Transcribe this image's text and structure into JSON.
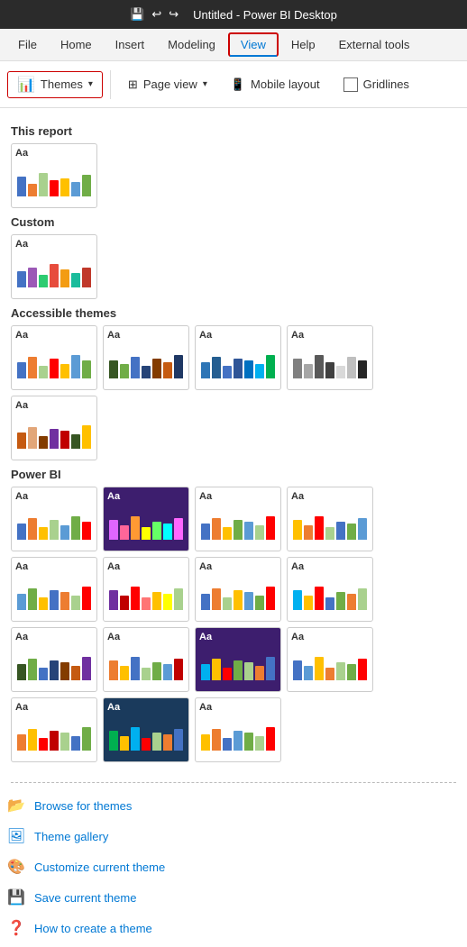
{
  "titleBar": {
    "title": "Untitled - Power BI Desktop",
    "saveIcon": "💾",
    "undoIcon": "↩",
    "redoIcon": "↪"
  },
  "menuBar": {
    "items": [
      {
        "label": "File",
        "active": false,
        "highlighted": false
      },
      {
        "label": "Home",
        "active": false,
        "highlighted": false
      },
      {
        "label": "Insert",
        "active": false,
        "highlighted": false
      },
      {
        "label": "Modeling",
        "active": false,
        "highlighted": false
      },
      {
        "label": "View",
        "active": true,
        "highlighted": true
      },
      {
        "label": "Help",
        "active": false,
        "highlighted": false
      },
      {
        "label": "External tools",
        "active": false,
        "highlighted": false
      }
    ]
  },
  "ribbon": {
    "themesLabel": "Themes",
    "pageViewLabel": "Page view",
    "mobileLayoutLabel": "Mobile layout",
    "gridlinesLabel": "Gridlines"
  },
  "dropdown": {
    "sections": [
      {
        "title": "This report",
        "themes": [
          {
            "id": "this-report-1",
            "aa": "Aa",
            "bg": "#fff",
            "bars": [
              {
                "color": "#4472c4",
                "h": 55
              },
              {
                "color": "#ed7d31",
                "h": 35
              },
              {
                "color": "#a9d18e",
                "h": 65
              },
              {
                "color": "#ff0000",
                "h": 45
              },
              {
                "color": "#ffc000",
                "h": 50
              },
              {
                "color": "#5b9bd5",
                "h": 40
              },
              {
                "color": "#70ad47",
                "h": 60
              }
            ]
          }
        ]
      },
      {
        "title": "Custom",
        "themes": [
          {
            "id": "custom-1",
            "aa": "Aa",
            "bg": "#fff",
            "bars": [
              {
                "color": "#4472c4",
                "h": 45
              },
              {
                "color": "#9b59b6",
                "h": 55
              },
              {
                "color": "#2ecc71",
                "h": 35
              },
              {
                "color": "#e74c3c",
                "h": 65
              },
              {
                "color": "#f39c12",
                "h": 50
              },
              {
                "color": "#1abc9c",
                "h": 40
              },
              {
                "color": "#c0392b",
                "h": 55
              }
            ]
          }
        ]
      },
      {
        "title": "Accessible themes",
        "themes": [
          {
            "id": "acc-1",
            "aa": "Aa",
            "bg": "#fff",
            "bars": [
              {
                "color": "#4472c4",
                "h": 45
              },
              {
                "color": "#ed7d31",
                "h": 60
              },
              {
                "color": "#a9d18e",
                "h": 35
              },
              {
                "color": "#ff0000",
                "h": 55
              },
              {
                "color": "#ffc000",
                "h": 40
              },
              {
                "color": "#5b9bd5",
                "h": 65
              },
              {
                "color": "#70ad47",
                "h": 50
              }
            ]
          },
          {
            "id": "acc-2",
            "aa": "Aa",
            "bg": "#fff",
            "bars": [
              {
                "color": "#375623",
                "h": 50
              },
              {
                "color": "#70ad47",
                "h": 40
              },
              {
                "color": "#4472c4",
                "h": 60
              },
              {
                "color": "#264478",
                "h": 35
              },
              {
                "color": "#833c00",
                "h": 55
              },
              {
                "color": "#c55a11",
                "h": 45
              },
              {
                "color": "#1f3864",
                "h": 65
              }
            ]
          },
          {
            "id": "acc-3",
            "aa": "Aa",
            "bg": "#fff",
            "bars": [
              {
                "color": "#2e75b6",
                "h": 45
              },
              {
                "color": "#255e91",
                "h": 60
              },
              {
                "color": "#4472c4",
                "h": 35
              },
              {
                "color": "#2f5597",
                "h": 55
              },
              {
                "color": "#0070c0",
                "h": 50
              },
              {
                "color": "#00b0f0",
                "h": 40
              },
              {
                "color": "#00b050",
                "h": 65
              }
            ]
          },
          {
            "id": "acc-4",
            "aa": "Aa",
            "bg": "#fff",
            "bars": [
              {
                "color": "#808080",
                "h": 55
              },
              {
                "color": "#a6a6a6",
                "h": 40
              },
              {
                "color": "#595959",
                "h": 65
              },
              {
                "color": "#404040",
                "h": 45
              },
              {
                "color": "#d9d9d9",
                "h": 35
              },
              {
                "color": "#bfbfbf",
                "h": 60
              },
              {
                "color": "#262626",
                "h": 50
              }
            ]
          },
          {
            "id": "acc-5",
            "aa": "Aa",
            "bg": "#fff",
            "bars": [
              {
                "color": "#c55a11",
                "h": 45
              },
              {
                "color": "#e2a679",
                "h": 60
              },
              {
                "color": "#833c00",
                "h": 35
              },
              {
                "color": "#7030a0",
                "h": 55
              },
              {
                "color": "#c00000",
                "h": 50
              },
              {
                "color": "#375623",
                "h": 40
              },
              {
                "color": "#ffc000",
                "h": 65
              }
            ]
          }
        ]
      },
      {
        "title": "Power BI",
        "themes": [
          {
            "id": "pbi-1",
            "aa": "Aa",
            "bg": "#fff",
            "bars": [
              {
                "color": "#4472c4",
                "h": 45
              },
              {
                "color": "#ed7d31",
                "h": 60
              },
              {
                "color": "#ffc000",
                "h": 35
              },
              {
                "color": "#a9d18e",
                "h": 55
              },
              {
                "color": "#5b9bd5",
                "h": 40
              },
              {
                "color": "#70ad47",
                "h": 65
              },
              {
                "color": "#ff0000",
                "h": 50
              }
            ]
          },
          {
            "id": "pbi-2",
            "aa": "Aa",
            "bg": "#3d1e6e",
            "darkBg": true,
            "bars": [
              {
                "color": "#e066ff",
                "h": 55
              },
              {
                "color": "#ff6699",
                "h": 40
              },
              {
                "color": "#ff9933",
                "h": 65
              },
              {
                "color": "#ffff00",
                "h": 35
              },
              {
                "color": "#66ff66",
                "h": 50
              },
              {
                "color": "#00ffff",
                "h": 45
              },
              {
                "color": "#ff66ff",
                "h": 60
              }
            ]
          },
          {
            "id": "pbi-3",
            "aa": "Aa",
            "bg": "#fff",
            "bars": [
              {
                "color": "#4472c4",
                "h": 45
              },
              {
                "color": "#ed7d31",
                "h": 60
              },
              {
                "color": "#ffc000",
                "h": 35
              },
              {
                "color": "#70ad47",
                "h": 55
              },
              {
                "color": "#5b9bd5",
                "h": 50
              },
              {
                "color": "#a9d18e",
                "h": 40
              },
              {
                "color": "#ff0000",
                "h": 65
              }
            ]
          },
          {
            "id": "pbi-4",
            "aa": "Aa",
            "bg": "#fff",
            "bars": [
              {
                "color": "#ffc000",
                "h": 55
              },
              {
                "color": "#ed7d31",
                "h": 40
              },
              {
                "color": "#ff0000",
                "h": 65
              },
              {
                "color": "#a9d18e",
                "h": 35
              },
              {
                "color": "#4472c4",
                "h": 50
              },
              {
                "color": "#70ad47",
                "h": 45
              },
              {
                "color": "#5b9bd5",
                "h": 60
              }
            ]
          },
          {
            "id": "pbi-5",
            "aa": "Aa",
            "bg": "#fff",
            "bars": [
              {
                "color": "#5b9bd5",
                "h": 45
              },
              {
                "color": "#70ad47",
                "h": 60
              },
              {
                "color": "#ffc000",
                "h": 35
              },
              {
                "color": "#4472c4",
                "h": 55
              },
              {
                "color": "#ed7d31",
                "h": 50
              },
              {
                "color": "#a9d18e",
                "h": 40
              },
              {
                "color": "#ff0000",
                "h": 65
              }
            ]
          },
          {
            "id": "pbi-6",
            "aa": "Aa",
            "bg": "#fff",
            "bars": [
              {
                "color": "#7030a0",
                "h": 55
              },
              {
                "color": "#c00000",
                "h": 40
              },
              {
                "color": "#ff0000",
                "h": 65
              },
              {
                "color": "#ff7575",
                "h": 35
              },
              {
                "color": "#ffc000",
                "h": 50
              },
              {
                "color": "#ffff00",
                "h": 45
              },
              {
                "color": "#a9d18e",
                "h": 60
              }
            ]
          },
          {
            "id": "pbi-7",
            "aa": "Aa",
            "bg": "#fff",
            "bars": [
              {
                "color": "#4472c4",
                "h": 45
              },
              {
                "color": "#ed7d31",
                "h": 60
              },
              {
                "color": "#a9d18e",
                "h": 35
              },
              {
                "color": "#ffc000",
                "h": 55
              },
              {
                "color": "#5b9bd5",
                "h": 50
              },
              {
                "color": "#70ad47",
                "h": 40
              },
              {
                "color": "#ff0000",
                "h": 65
              }
            ]
          },
          {
            "id": "pbi-8",
            "aa": "Aa",
            "bg": "#fff",
            "bars": [
              {
                "color": "#00b0f0",
                "h": 55
              },
              {
                "color": "#ffc000",
                "h": 40
              },
              {
                "color": "#ff0000",
                "h": 65
              },
              {
                "color": "#4472c4",
                "h": 35
              },
              {
                "color": "#70ad47",
                "h": 50
              },
              {
                "color": "#ed7d31",
                "h": 45
              },
              {
                "color": "#a9d18e",
                "h": 60
              }
            ]
          },
          {
            "id": "pbi-9",
            "aa": "Aa",
            "bg": "#fff",
            "bars": [
              {
                "color": "#375623",
                "h": 45
              },
              {
                "color": "#70ad47",
                "h": 60
              },
              {
                "color": "#4472c4",
                "h": 35
              },
              {
                "color": "#264478",
                "h": 55
              },
              {
                "color": "#833c00",
                "h": 50
              },
              {
                "color": "#c55a11",
                "h": 40
              },
              {
                "color": "#7030a0",
                "h": 65
              }
            ]
          },
          {
            "id": "pbi-10",
            "aa": "Aa",
            "bg": "#fff",
            "bars": [
              {
                "color": "#ed7d31",
                "h": 55
              },
              {
                "color": "#ffc000",
                "h": 40
              },
              {
                "color": "#4472c4",
                "h": 65
              },
              {
                "color": "#a9d18e",
                "h": 35
              },
              {
                "color": "#70ad47",
                "h": 50
              },
              {
                "color": "#5b9bd5",
                "h": 45
              },
              {
                "color": "#c00000",
                "h": 60
              }
            ]
          },
          {
            "id": "pbi-11",
            "aa": "Aa",
            "bg": "#1a1a3e",
            "darkBg": true,
            "bars": [
              {
                "color": "#00b0f0",
                "h": 45
              },
              {
                "color": "#ffc000",
                "h": 60
              },
              {
                "color": "#ff0000",
                "h": 35
              },
              {
                "color": "#70ad47",
                "h": 55
              },
              {
                "color": "#a9d18e",
                "h": 50
              },
              {
                "color": "#ed7d31",
                "h": 40
              },
              {
                "color": "#4472c4",
                "h": 65
              }
            ]
          },
          {
            "id": "pbi-12",
            "aa": "Aa",
            "bg": "#fff",
            "bars": [
              {
                "color": "#4472c4",
                "h": 55
              },
              {
                "color": "#5b9bd5",
                "h": 40
              },
              {
                "color": "#ffc000",
                "h": 65
              },
              {
                "color": "#ed7d31",
                "h": 35
              },
              {
                "color": "#a9d18e",
                "h": 50
              },
              {
                "color": "#70ad47",
                "h": 45
              },
              {
                "color": "#ff0000",
                "h": 60
              }
            ]
          },
          {
            "id": "pbi-13",
            "aa": "Aa",
            "bg": "#fff",
            "bars": [
              {
                "color": "#ed7d31",
                "h": 45
              },
              {
                "color": "#ffc000",
                "h": 60
              },
              {
                "color": "#ff0000",
                "h": 35
              },
              {
                "color": "#c00000",
                "h": 55
              },
              {
                "color": "#a9d18e",
                "h": 50
              },
              {
                "color": "#4472c4",
                "h": 40
              },
              {
                "color": "#70ad47",
                "h": 65
              }
            ]
          },
          {
            "id": "pbi-14",
            "aa": "Aa",
            "bg": "#1a3a5c",
            "darkBg2": true,
            "bars": [
              {
                "color": "#00b050",
                "h": 55
              },
              {
                "color": "#ffc000",
                "h": 40
              },
              {
                "color": "#00b0f0",
                "h": 65
              },
              {
                "color": "#ff0000",
                "h": 35
              },
              {
                "color": "#a9d18e",
                "h": 50
              },
              {
                "color": "#ed7d31",
                "h": 45
              },
              {
                "color": "#4472c4",
                "h": 60
              }
            ]
          },
          {
            "id": "pbi-15",
            "aa": "Aa",
            "bg": "#fff",
            "bars": [
              {
                "color": "#ffc000",
                "h": 45
              },
              {
                "color": "#ed7d31",
                "h": 60
              },
              {
                "color": "#4472c4",
                "h": 35
              },
              {
                "color": "#5b9bd5",
                "h": 55
              },
              {
                "color": "#70ad47",
                "h": 50
              },
              {
                "color": "#a9d18e",
                "h": 40
              },
              {
                "color": "#ff0000",
                "h": 65
              }
            ]
          }
        ]
      }
    ],
    "bottomMenu": [
      {
        "label": "Browse for themes",
        "icon": "📂",
        "id": "browse-themes"
      },
      {
        "label": "Theme gallery",
        "icon": "🖼",
        "id": "theme-gallery"
      },
      {
        "label": "Customize current theme",
        "icon": "🎨",
        "id": "customize-theme"
      },
      {
        "label": "Save current theme",
        "icon": "💾",
        "id": "save-theme"
      },
      {
        "label": "How to create a theme",
        "icon": "❓",
        "id": "how-to-theme"
      }
    ]
  }
}
